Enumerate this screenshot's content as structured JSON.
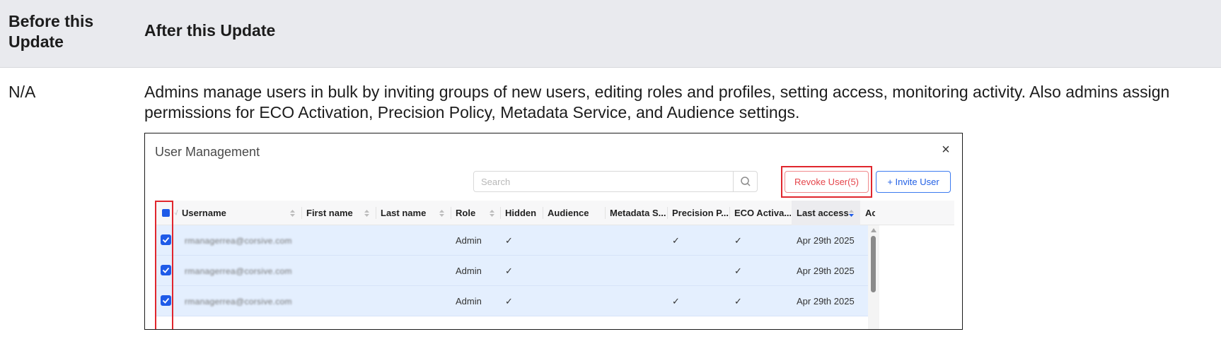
{
  "header": {
    "before_label": "Before this Update",
    "after_label": "After this Update"
  },
  "row": {
    "before_value": "N/A",
    "description_line1": "Admins manage users in bulk by inviting groups of new users, editing roles and profiles, setting access, monitoring activity. Also admins assign",
    "description_line2": "permissions for ECO Activation, Precision Policy, Metadata Service, and Audience settings."
  },
  "dialog": {
    "title": "User Management",
    "close_glyph": "×",
    "search_placeholder": "Search",
    "revoke_label": "Revoke User(5)",
    "invite_label": "+ Invite User",
    "columns": [
      "Username",
      "First name",
      "Last name",
      "Role",
      "Hidden",
      "Audience",
      "Metadata S...",
      "Precision P...",
      "ECO Activa...",
      "Last access",
      "Act"
    ],
    "rows": [
      {
        "username": "rmanagerrea@corsive.com",
        "role": "Admin",
        "hidden": "✓",
        "precision": "✓",
        "eco": "✓",
        "last_access": "Apr 29th 2025"
      },
      {
        "username": "rmanagerrea@corsive.com",
        "role": "Admin",
        "hidden": "✓",
        "precision": "",
        "eco": "✓",
        "last_access": "Apr 29th 2025"
      },
      {
        "username": "rmanagerrea@corsive.com",
        "role": "Admin",
        "hidden": "✓",
        "precision": "✓",
        "eco": "✓",
        "last_access": "Apr 29th 2025"
      }
    ]
  },
  "colors": {
    "highlight_red": "#e0262d",
    "primary_blue": "#1f5be8",
    "row_selected_bg": "#e4effe"
  }
}
